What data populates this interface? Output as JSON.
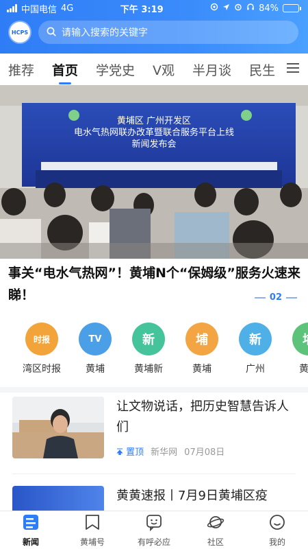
{
  "status_bar": {
    "carrier": "中国电信",
    "network": "4G",
    "time": "下午 3:19",
    "battery": "84%",
    "battery_level": 0.84
  },
  "header": {
    "logo_text": "HCPS",
    "search_placeholder": "请输入搜索的关键字"
  },
  "tabs": [
    {
      "label": "推荐"
    },
    {
      "label": "首页",
      "active": true
    },
    {
      "label": "学党史"
    },
    {
      "label": "V观"
    },
    {
      "label": "半月谈"
    },
    {
      "label": "民生"
    }
  ],
  "hero": {
    "banner_lines": [
      "黄埔区  广州开发区",
      "电水气热网联办改革暨联合服务平台上线",
      "新闻发布会"
    ],
    "title": "事关“电水气热网”！黄埔N个“保姆级”服务火速来睇！",
    "page": "02"
  },
  "quick_channels": [
    {
      "label": "湾区时报",
      "icon_text": "时报",
      "color": "#f2a43a"
    },
    {
      "label": "黄埔",
      "icon_text": "TV",
      "color": "#4a9fe6"
    },
    {
      "label": "黄埔新",
      "icon_text": "新",
      "color": "#45c39a"
    },
    {
      "label": "黄埔",
      "icon_text": "埔",
      "color": "#f3a443"
    },
    {
      "label": "广州",
      "icon_text": "新",
      "color": "#4fb0e8"
    },
    {
      "label": "黄埔",
      "icon_text": "埔",
      "color": "#5dc37a"
    }
  ],
  "news": [
    {
      "title": "让文物说话，把历史智慧告诉人们",
      "tag": "置顶",
      "source": "新华网",
      "date": "07月08日"
    },
    {
      "title": "黄黄速报丨7月9日黄埔区疫"
    }
  ],
  "bottom_nav": [
    {
      "label": "新闻",
      "icon": "news-icon",
      "active": true
    },
    {
      "label": "黄埔号",
      "icon": "bookmark-icon"
    },
    {
      "label": "有呼必应",
      "icon": "chat-smile-icon"
    },
    {
      "label": "社区",
      "icon": "planet-icon"
    },
    {
      "label": "我的",
      "icon": "face-icon"
    }
  ],
  "colors": {
    "accent": "#2f7df6",
    "header_bg": "#3a8bfb"
  }
}
